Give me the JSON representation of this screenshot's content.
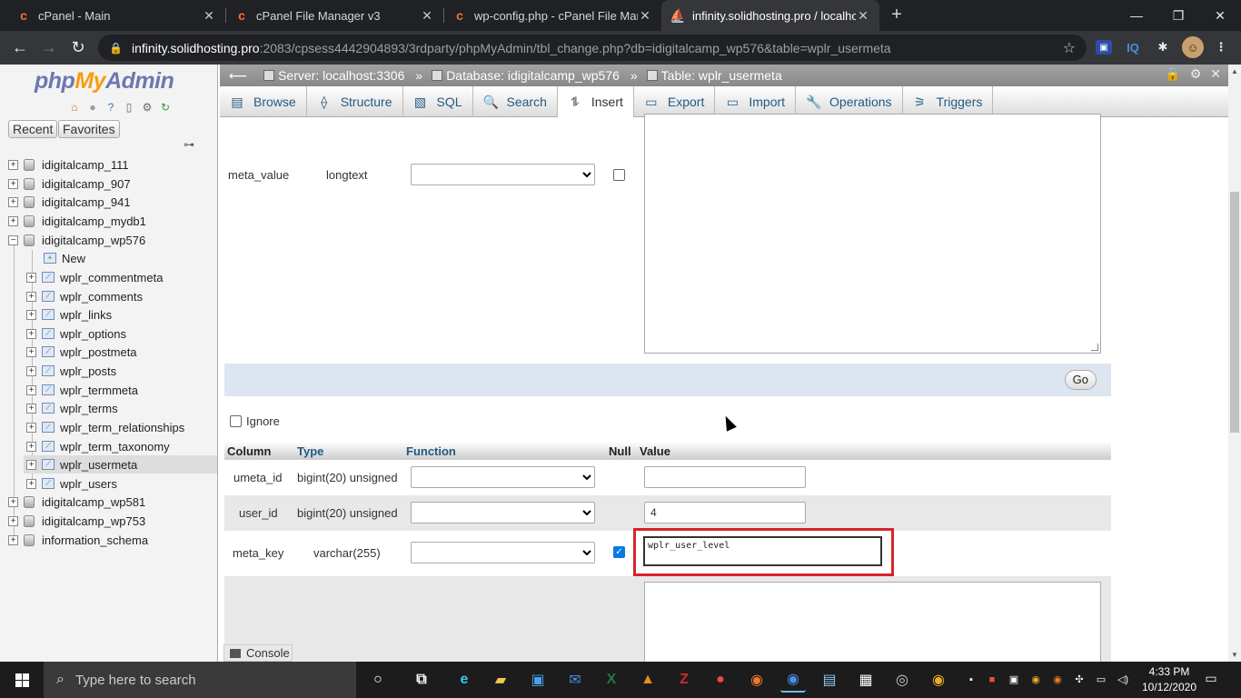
{
  "browser": {
    "tabs": [
      {
        "title": "cPanel - Main"
      },
      {
        "title": "cPanel File Manager v3"
      },
      {
        "title": "wp-config.php - cPanel File Mana"
      },
      {
        "title": "infinity.solidhosting.pro / localho"
      }
    ],
    "url_host": "infinity.solidhosting.pro",
    "url_path": ":2083/cpsess4442904893/3rdparty/phpMyAdmin/tbl_change.php?db=idigitalcamp_wp576&table=wplr_usermeta",
    "ext_iq": "IQ"
  },
  "sidebar": {
    "logo_php": "php",
    "logo_my": "My",
    "logo_admin": "Admin",
    "recent": "Recent",
    "favorites": "Favorites",
    "databases": [
      {
        "name": "idigitalcamp_111"
      },
      {
        "name": "idigitalcamp_907"
      },
      {
        "name": "idigitalcamp_941"
      },
      {
        "name": "idigitalcamp_mydb1"
      },
      {
        "name": "idigitalcamp_wp576"
      }
    ],
    "new_label": "New",
    "tables": [
      {
        "name": "wplr_commentmeta"
      },
      {
        "name": "wplr_comments"
      },
      {
        "name": "wplr_links"
      },
      {
        "name": "wplr_options"
      },
      {
        "name": "wplr_postmeta"
      },
      {
        "name": "wplr_posts"
      },
      {
        "name": "wplr_termmeta"
      },
      {
        "name": "wplr_terms"
      },
      {
        "name": "wplr_term_relationships"
      },
      {
        "name": "wplr_term_taxonomy"
      },
      {
        "name": "wplr_usermeta"
      },
      {
        "name": "wplr_users"
      }
    ],
    "databases_after": [
      {
        "name": "idigitalcamp_wp581"
      },
      {
        "name": "idigitalcamp_wp753"
      },
      {
        "name": "information_schema"
      }
    ]
  },
  "breadcrumb": {
    "server": "Server: localhost:3306",
    "database": "Database: idigitalcamp_wp576",
    "table": "Table: wplr_usermeta"
  },
  "menu": {
    "browse": "Browse",
    "structure": "Structure",
    "sql": "SQL",
    "search": "Search",
    "insert": "Insert",
    "export": "Export",
    "import": "Import",
    "operations": "Operations",
    "triggers": "Triggers"
  },
  "form_top": {
    "meta_value_col": "meta_value",
    "meta_value_type": "longtext",
    "go": "Go"
  },
  "form2": {
    "ignore": "Ignore",
    "headers": {
      "column": "Column",
      "type": "Type",
      "function": "Function",
      "null": "Null",
      "value": "Value"
    },
    "rows": [
      {
        "column": "umeta_id",
        "type": "bigint(20) unsigned",
        "value": ""
      },
      {
        "column": "user_id",
        "type": "bigint(20) unsigned",
        "value": "4"
      },
      {
        "column": "meta_key",
        "type": "varchar(255)",
        "value": "wplr_user_level"
      }
    ]
  },
  "console": "Console",
  "taskbar": {
    "search_placeholder": "Type here to search",
    "time": "4:33 PM",
    "date": "10/12/2020"
  }
}
